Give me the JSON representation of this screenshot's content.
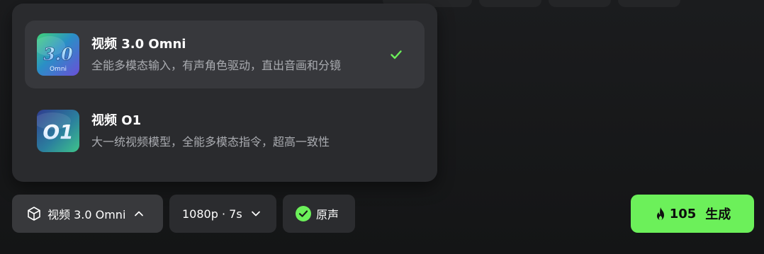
{
  "dropdown": {
    "items": [
      {
        "name": "视频 3.0 Omni",
        "description": "全能多模态输入，有声角色驱动，直出音画和分镜",
        "thumb_text": "3.0",
        "thumb_subtext": "Omni",
        "selected": true,
        "icon": "check-icon"
      },
      {
        "name": "视频 O1",
        "description": "大一统视频模型，全能多模态指令，超高一致性",
        "thumb_text": "O1",
        "selected": false
      }
    ]
  },
  "toolbar": {
    "model_label": "视频 3.0 Omni",
    "model_icon": "cube-icon",
    "resolution_label": "1080p · 7s",
    "audio_label": "原声",
    "audio_icon": "check-circle-icon",
    "generate_cost": "105",
    "generate_label": "生成"
  },
  "colors": {
    "accent": "#6cf05a",
    "panel_bg": "#2a2b2e",
    "selected_bg": "#37383c"
  }
}
